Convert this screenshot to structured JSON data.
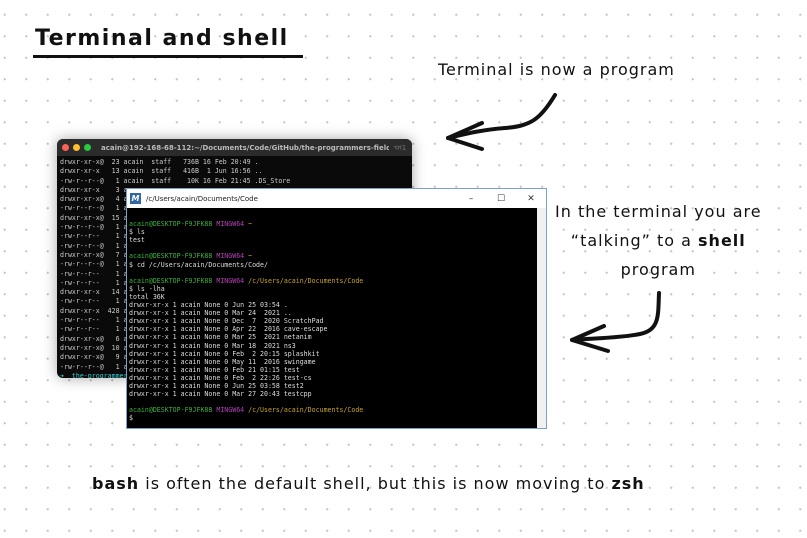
{
  "title": "Terminal and shell",
  "notes": {
    "terminal_program": "Terminal is now a program",
    "shell_line1": "In the terminal you are",
    "shell_line2_a": "“talking”  to a ",
    "shell_line2_b": "shell",
    "shell_line3": "program",
    "bottom_a": "bash",
    "bottom_b": " is often the default shell, but this is now moving to ",
    "bottom_c": "zsh"
  },
  "mac_terminal": {
    "title": "acain@192-168-68-112:~/Documents/Code/GitHub/the-programmers-field-gui...",
    "shortcut": "⌥⌘1",
    "lines": [
      "drwxr-xr-x@  23 acain  staff   736B 16 Feb 20:49 .",
      "drwxr-xr-x   13 acain  staff   416B  1 Jun 16:56 ..",
      "-rw-r--r--@   1 acain  staff    10K 16 Feb 21:45 .DS_Store",
      "drwxr-xr-x    3 a",
      "drwxr-xr-x@   4 a",
      "-rw-r--r--@   1 a",
      "drwxr-xr-x@  15 a",
      "-rw-r--r--@   1 a",
      "-rw-r--r--    1 a",
      "-rw-r--r--@   1 a",
      "drwxr-xr-x@   7 a",
      "-rw-r--r--@   1 a",
      "-rw-r--r--    1 a",
      "-rw-r--r--    1 a",
      "drwxr-xr-x   14 a",
      "-rw-r--r--    1 a",
      "drwxr-xr-x  428 a",
      "-rw-r--r--    1 a",
      "-rw-r--r--    1 a",
      "drwxr-xr-x@   6 a",
      "drwxr-xr-x@  10 a",
      "drwxr-xr-x@   9 a",
      "-rw-r--r--@   1 a"
    ],
    "prompt": "➜  the-programmer"
  },
  "win_terminal": {
    "title": "/c/Users/acain/Documents/Code",
    "logo": "M",
    "user": "acain@DESKTOP-F9JFK88",
    "env": "MINGW64",
    "home": "~",
    "cwd": "/c/Users/acain/Documents/Code",
    "cmd1": "$ ls",
    "out1": "test",
    "cmd2": "$ cd /c/Users/acain/Documents/Code/",
    "cmd3": "$ ls -lha",
    "total": "total 36K",
    "listing": [
      "drwxr-xr-x 1 acain None 0 Jun 25 03:54 .",
      "drwxr-xr-x 1 acain None 0 Mar 24  2021 ..",
      "drwxr-xr-x 1 acain None 0 Dec  7  2020 ScratchPad",
      "drwxr-xr-x 1 acain None 0 Apr 22  2016 cave-escape",
      "drwxr-xr-x 1 acain None 0 Mar 25  2021 netanim",
      "drwxr-xr-x 1 acain None 0 Mar 18  2021 ns3",
      "drwxr-xr-x 1 acain None 0 Feb  2 20:15 splashkit",
      "drwxr-xr-x 1 acain None 0 May 11  2016 swingame",
      "drwxr-xr-x 1 acain None 0 Feb 21 01:15 test",
      "drwxr-xr-x 1 acain None 0 Feb  2 22:26 test-cs",
      "drwxr-xr-x 1 acain None 0 Jun 25 03:58 test2",
      "drwxr-xr-x 1 acain None 0 Mar 27 20:43 testcpp"
    ],
    "prompt": "$",
    "minimize": "–",
    "maximize": "☐",
    "close": "✕"
  },
  "colors": {
    "user": "#3fb13f",
    "env": "#b440b4",
    "path": "#c8a32a",
    "mac_red": "#ff5f57",
    "mac_yellow": "#febc2e",
    "mac_green": "#28c840"
  }
}
